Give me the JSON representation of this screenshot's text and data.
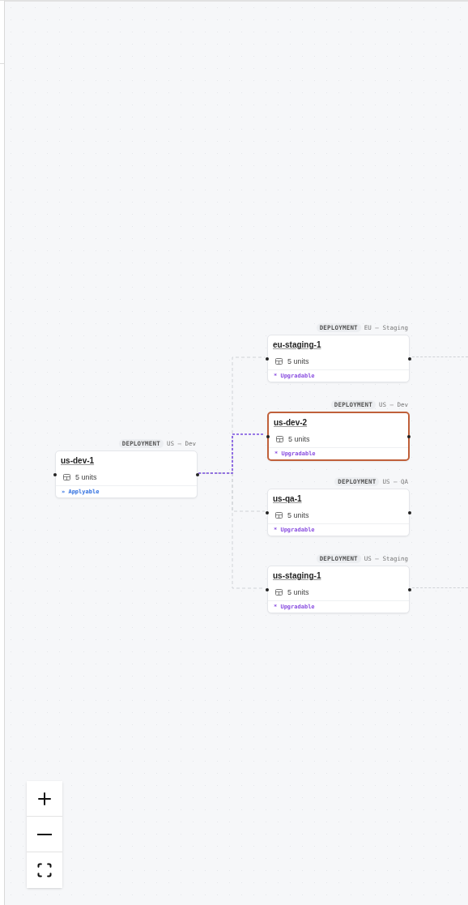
{
  "diagram": {
    "root": {
      "type_label": "DEPLOYMENT",
      "environment": "US – Dev",
      "name": "us-dev-1",
      "units": "5 units",
      "status": {
        "kind": "applyable",
        "icon": "»",
        "label": "Applyable"
      },
      "selected": false,
      "children": [
        {
          "type_label": "DEPLOYMENT",
          "environment": "EU – Staging",
          "name": "eu-staging-1",
          "units": "5 units",
          "status": {
            "kind": "upgradable",
            "icon": "*",
            "label": "Upgradable"
          },
          "selected": false,
          "edge_highlighted": false,
          "has_outgoing": true
        },
        {
          "type_label": "DEPLOYMENT",
          "environment": "US – Dev",
          "name": "us-dev-2",
          "units": "5 units",
          "status": {
            "kind": "upgradable",
            "icon": "*",
            "label": "Upgradable"
          },
          "selected": true,
          "edge_highlighted": true
        },
        {
          "type_label": "DEPLOYMENT",
          "environment": "US – QA",
          "name": "us-qa-1",
          "units": "5 units",
          "status": {
            "kind": "upgradable",
            "icon": "*",
            "label": "Upgradable"
          },
          "selected": false,
          "edge_highlighted": false
        },
        {
          "type_label": "DEPLOYMENT",
          "environment": "US – Staging",
          "name": "us-staging-1",
          "units": "5 units",
          "status": {
            "kind": "upgradable",
            "icon": "*",
            "label": "Upgradable"
          },
          "selected": false,
          "edge_highlighted": false,
          "has_outgoing": true
        }
      ]
    }
  },
  "zoom_controls": [
    {
      "kind": "zoom_in"
    },
    {
      "kind": "zoom_out"
    },
    {
      "kind": "fit_view"
    }
  ]
}
